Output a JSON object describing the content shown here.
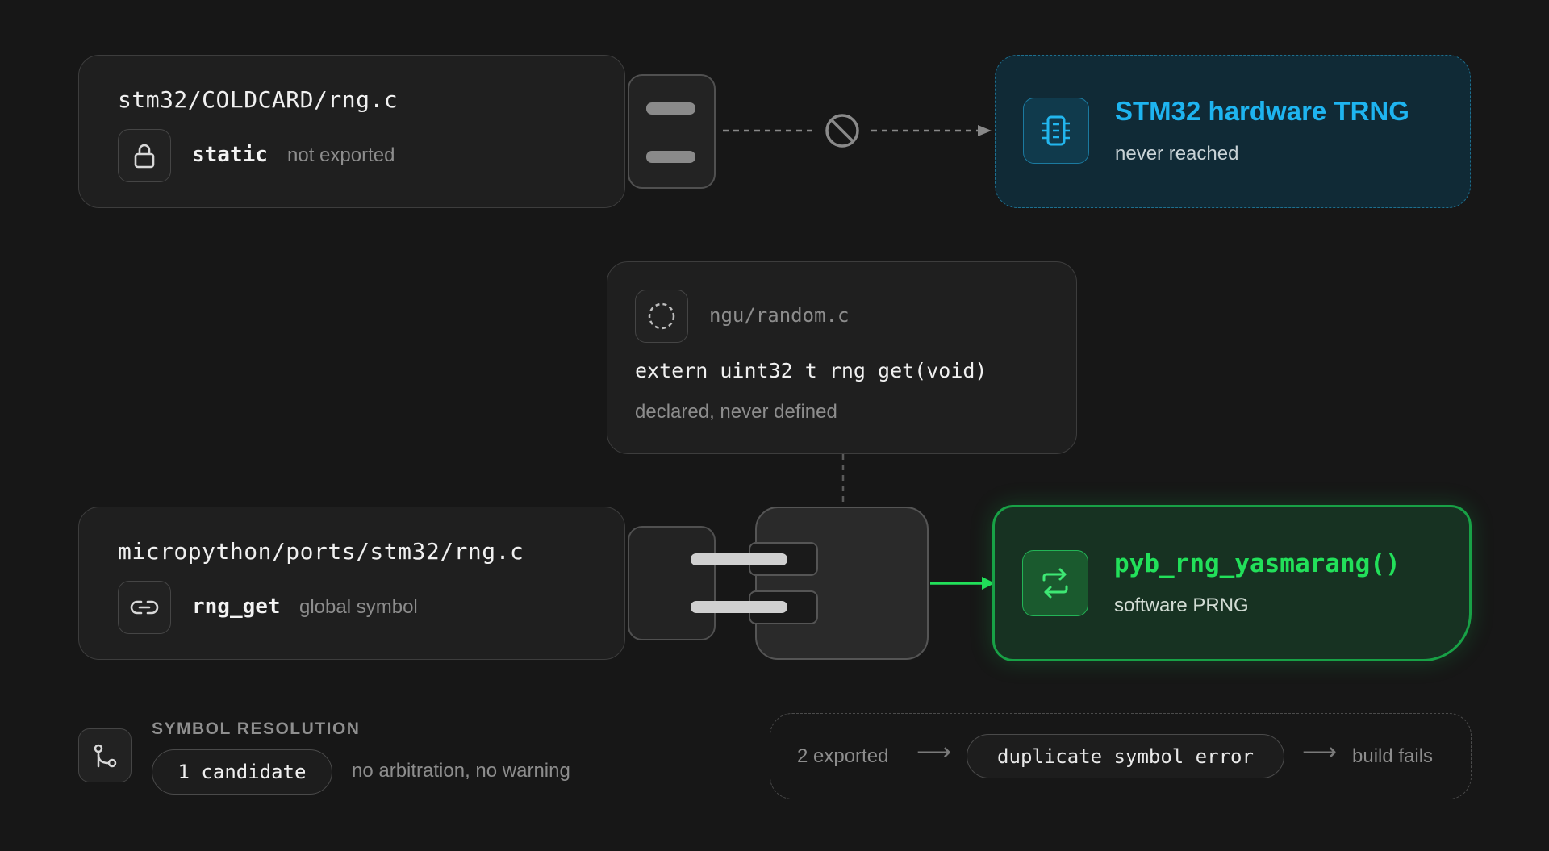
{
  "top_source": {
    "path": "stm32/COLDCARD/rng.c",
    "keyword": "static",
    "note": "not exported"
  },
  "trng": {
    "title": "STM32 hardware TRNG",
    "subtitle": "never reached"
  },
  "ngu": {
    "path": "ngu/random.c",
    "declaration": "extern uint32_t rng_get(void)",
    "note": "declared, never defined"
  },
  "bottom_source": {
    "path": "micropython/ports/stm32/rng.c",
    "symbol": "rng_get",
    "note": "global symbol"
  },
  "prng": {
    "title": "pyb_rng_yasmarang()",
    "subtitle": "software PRNG"
  },
  "resolution": {
    "label": "SYMBOL RESOLUTION",
    "count": "1 candidate",
    "note": "no arbitration, no warning"
  },
  "alternative": {
    "exported": "2 exported",
    "error": "duplicate symbol error",
    "result": "build fails"
  },
  "colors": {
    "background": "#171717",
    "trng_accent": "#1eb4f0",
    "prng_accent": "#22e05a"
  },
  "icons": [
    "lock-icon",
    "blocked-icon",
    "chip-icon",
    "dashed-circle-icon",
    "link-icon",
    "swap-arrows-icon",
    "branch-icon"
  ]
}
